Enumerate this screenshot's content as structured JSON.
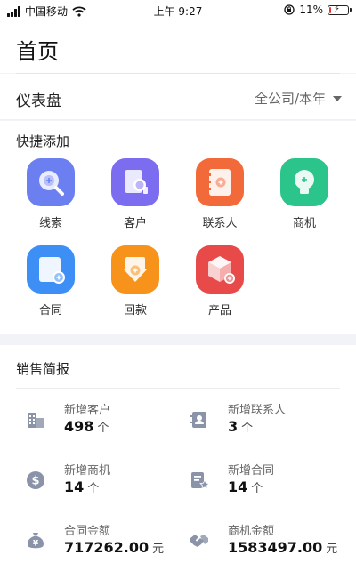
{
  "status_bar": {
    "carrier": "中国移动",
    "time": "上午 9:27",
    "battery": "11%",
    "battery_level": 0.11,
    "icons": [
      "signal-icon",
      "wifi-icon",
      "orientation-lock-icon",
      "battery-icon"
    ]
  },
  "header": {
    "title": "首页"
  },
  "dashboard": {
    "title": "仪表盘",
    "scope": "全公司/本年"
  },
  "quick_add": {
    "title": "快捷添加",
    "items": [
      {
        "label": "线索",
        "icon": "lead-search-icon",
        "color": "#6b7ff0"
      },
      {
        "label": "客户",
        "icon": "customer-card-icon",
        "color": "#7b6cf0"
      },
      {
        "label": "联系人",
        "icon": "contact-book-icon",
        "color": "#f26a3a"
      },
      {
        "label": "商机",
        "icon": "opportunity-bulb-icon",
        "color": "#2bc48a"
      },
      {
        "label": "合同",
        "icon": "contract-doc-icon",
        "color": "#3d8ef5"
      },
      {
        "label": "回款",
        "icon": "payment-return-icon",
        "color": "#f7931a"
      },
      {
        "label": "产品",
        "icon": "product-box-icon",
        "color": "#e84a4a"
      }
    ]
  },
  "sales_report": {
    "title": "销售简报",
    "stats": [
      {
        "label": "新增客户",
        "value": "498",
        "unit": "个",
        "icon": "building-icon"
      },
      {
        "label": "新增联系人",
        "value": "3",
        "unit": "个",
        "icon": "contact-card-icon"
      },
      {
        "label": "新增商机",
        "value": "14",
        "unit": "个",
        "icon": "dollar-coin-icon"
      },
      {
        "label": "新增合同",
        "value": "14",
        "unit": "个",
        "icon": "contract-star-icon"
      },
      {
        "label": "合同金额",
        "value": "717262.00",
        "unit": "元",
        "icon": "money-bag-icon"
      },
      {
        "label": "商机金额",
        "value": "1583497.00",
        "unit": "元",
        "icon": "handshake-icon"
      }
    ]
  },
  "colors": {
    "stat_icon": "#8a93a8",
    "accent_red": "#e53935"
  }
}
